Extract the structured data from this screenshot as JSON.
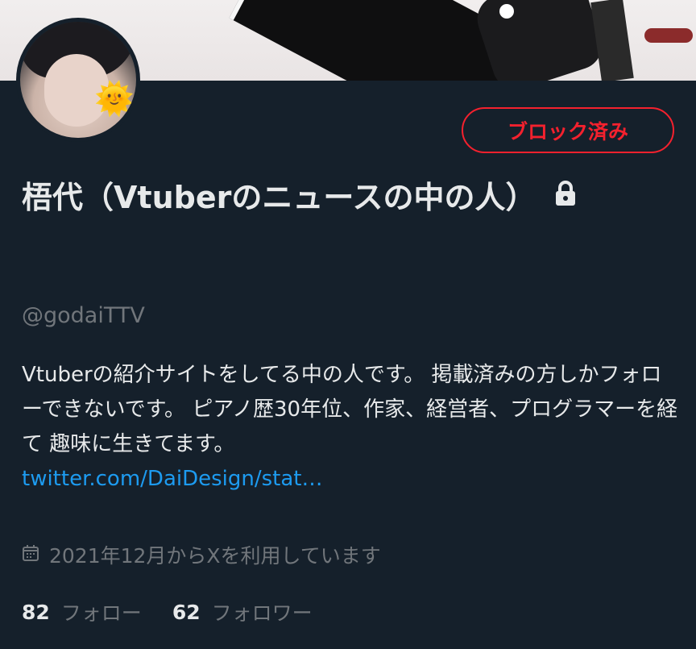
{
  "profile": {
    "block_button_label": "ブロック済み",
    "name": "梧代（Vtuberのニュースの中の人）",
    "handle": "@godaiTTV",
    "bio_text": "Vtuberの紹介サイトをしてる中の人です。 掲載済みの方しかフォローできないです。 ピアノ歴30年位、作家、経営者、プログラマーを経て 趣味に生きてます。",
    "bio_link": "twitter.com/DaiDesign/stat…",
    "joined": "2021年12月からXを利用しています",
    "following_count": "82",
    "following_label": "フォロー",
    "followers_count": "62",
    "followers_label": "フォロワー"
  },
  "icons": {
    "lock": "lock-icon",
    "calendar": "calendar-icon",
    "avatar_sticker": "sun-emoji"
  },
  "colors": {
    "background": "#15202b",
    "block_red": "#f4212e",
    "link_blue": "#1d9bf0",
    "text_primary": "#e7e9ea",
    "text_secondary": "#71767b"
  }
}
